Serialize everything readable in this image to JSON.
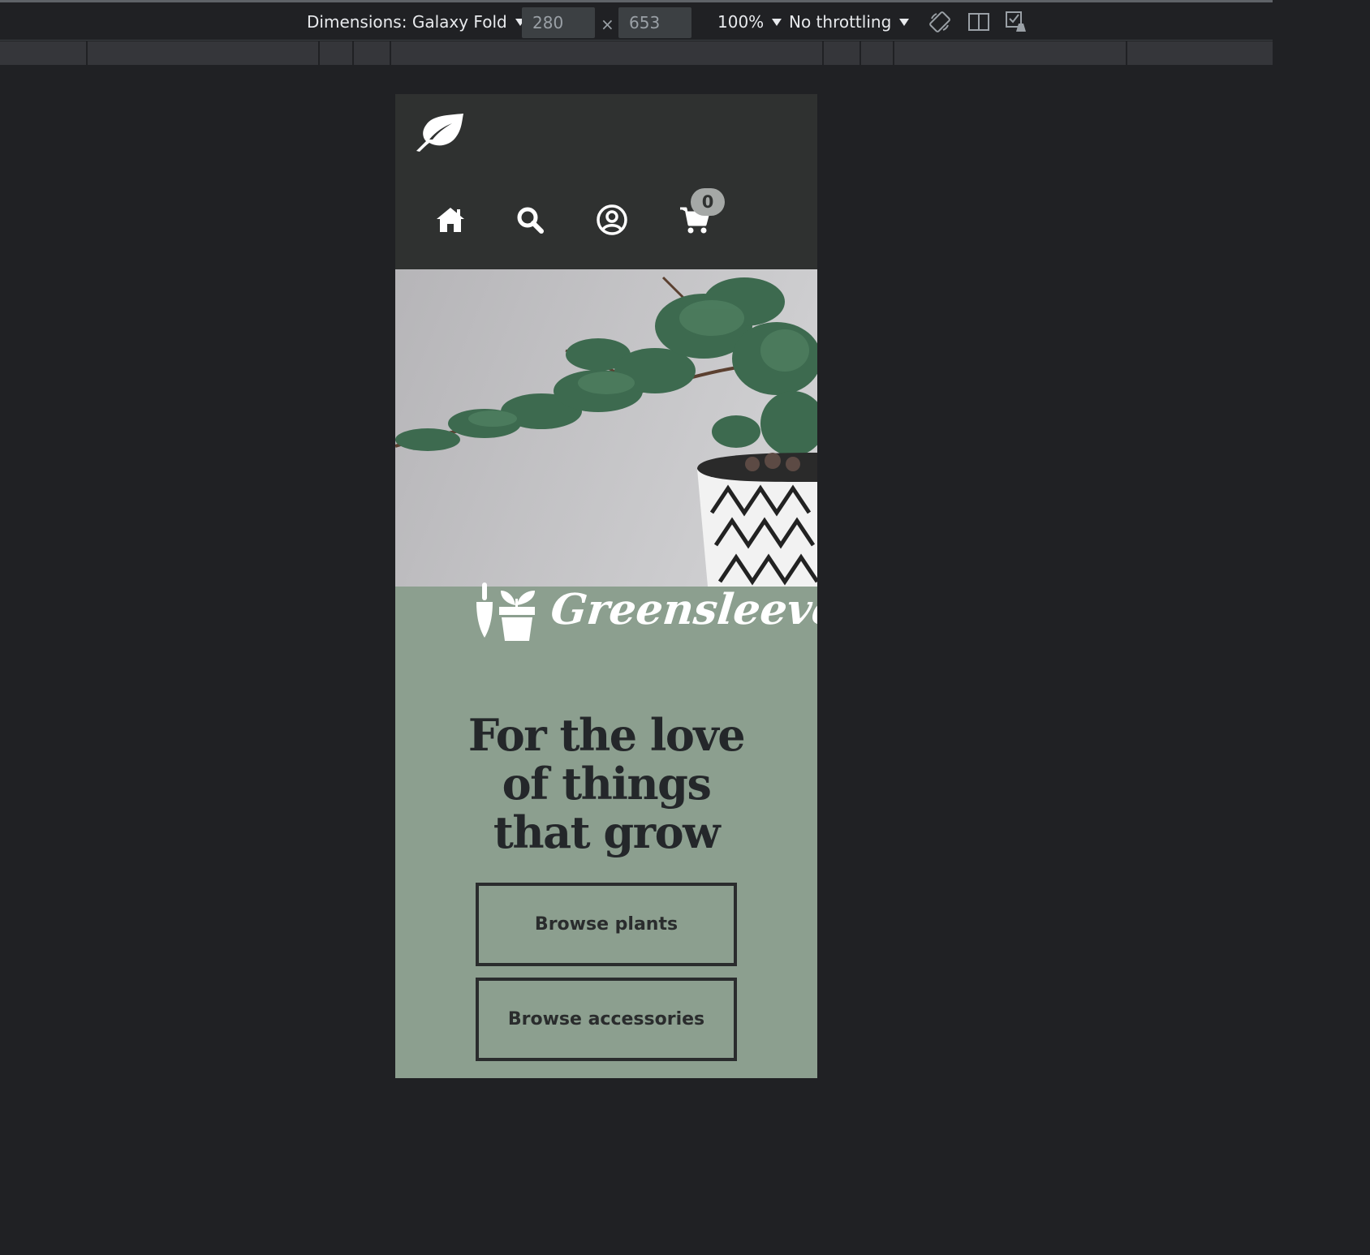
{
  "devtools": {
    "dimensions_label": "Dimensions: Galaxy Fold",
    "width_value": "280",
    "height_value": "653",
    "times_symbol": "×",
    "zoom_label": "100%",
    "throttling_label": "No throttling",
    "icons": [
      "rotate-icon",
      "dual-screen-icon",
      "sensor-check-icon"
    ]
  },
  "site": {
    "logo_icon": "leaf-icon",
    "nav": [
      {
        "icon": "home-icon"
      },
      {
        "icon": "search-icon"
      },
      {
        "icon": "account-icon"
      },
      {
        "icon": "cart-icon"
      }
    ],
    "cart_count": "0",
    "brand_icon": "garden-trowel-pot-icon",
    "brand_name": "Greensleeves",
    "tagline": "For the love of things that grow",
    "buttons": {
      "browse_plants": "Browse plants",
      "browse_accessories": "Browse accessories"
    },
    "colors": {
      "header_bg": "#2f3130",
      "hero_bg": "#8c9f8f",
      "text_dark": "#24272a"
    }
  }
}
